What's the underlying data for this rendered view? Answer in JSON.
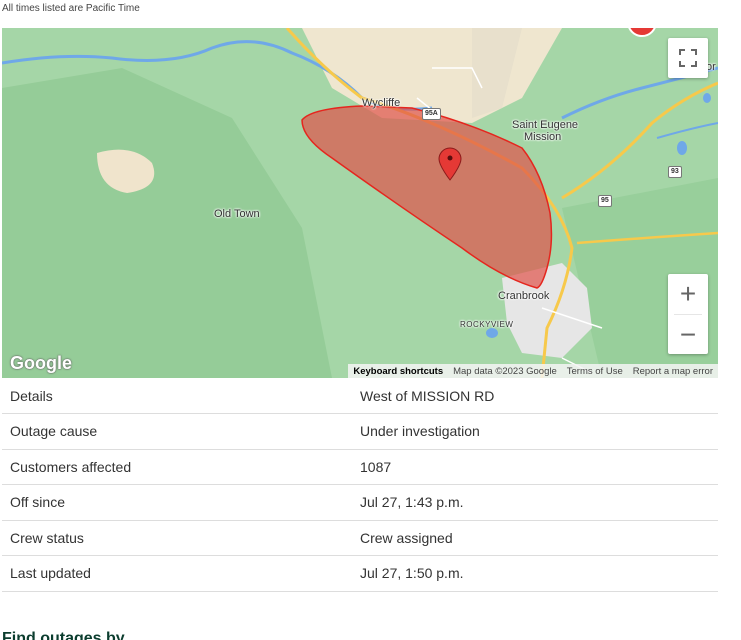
{
  "timezone_note": "All times listed are Pacific Time",
  "map": {
    "places": {
      "wycliffe": "Wycliffe",
      "saint_eugene_1": "Saint Eugene",
      "saint_eugene_2": "Mission",
      "old_town": "Old Town",
      "cranbrook": "Cranbrook",
      "rockyview": "ROCKYVIEW",
      "fort_partial": "or"
    },
    "highways": {
      "h95a": "95A",
      "h93": "93",
      "h95": "95"
    },
    "controls": {
      "zoom_in": "+",
      "zoom_out": "−"
    },
    "logo": "Google",
    "attribution": {
      "keyboard_shortcuts": "Keyboard shortcuts",
      "map_data": "Map data ©2023 Google",
      "terms": "Terms of Use",
      "report": "Report a map error"
    },
    "outage_area_color": "#e0534a",
    "outage_border_color": "#e5261e"
  },
  "details": [
    {
      "label": "Details",
      "value": "West of MISSION RD"
    },
    {
      "label": "Outage cause",
      "value": "Under investigation"
    },
    {
      "label": "Customers affected",
      "value": "1087"
    },
    {
      "label": "Off since",
      "value": "Jul 27, 1:43 p.m."
    },
    {
      "label": "Crew status",
      "value": "Crew assigned"
    },
    {
      "label": "Last updated",
      "value": "Jul 27, 1:50 p.m."
    }
  ],
  "footer_heading": "Find outages by"
}
